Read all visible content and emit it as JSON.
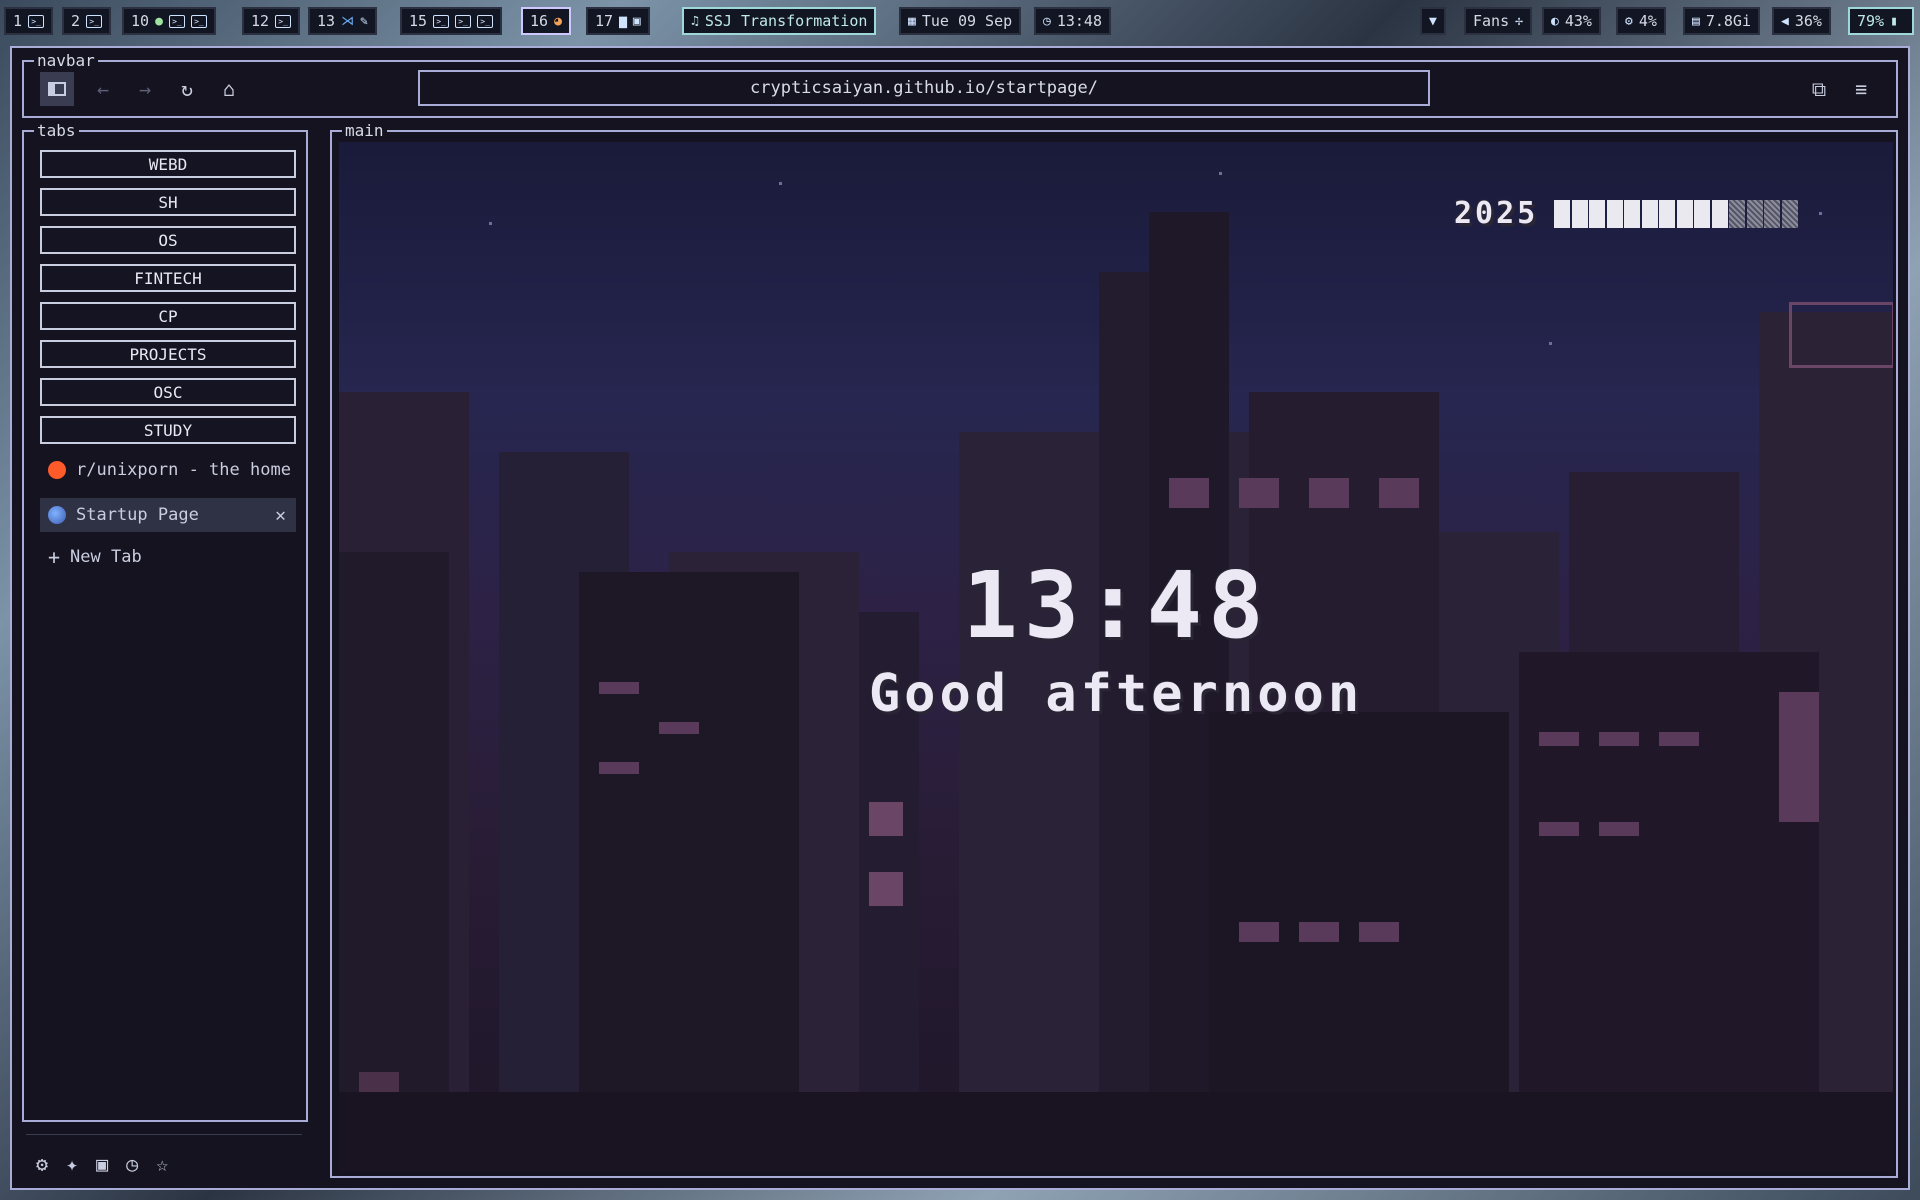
{
  "topbar": {
    "workspaces": [
      {
        "num": "1",
        "icons": [
          "terminal-icon"
        ]
      },
      {
        "num": "2",
        "icons": [
          "terminal-icon"
        ]
      },
      {
        "num": "10",
        "icons": [
          "spotify-icon",
          "terminal-icon",
          "terminal-icon"
        ]
      },
      {
        "num": "12",
        "icons": [
          "terminal-icon"
        ]
      },
      {
        "num": "13",
        "icons": [
          "vscode-icon",
          "editor-icon"
        ]
      },
      {
        "num": "15",
        "icons": [
          "terminal-icon",
          "terminal-icon",
          "terminal-icon"
        ]
      },
      {
        "num": "16",
        "icons": [
          "firefox-icon"
        ],
        "active": true
      },
      {
        "num": "17",
        "icons": [
          "folder-icon",
          "image-viewer-icon"
        ]
      }
    ],
    "music": "SSJ Transformation",
    "date": "Tue 09 Sep",
    "time": "13:48",
    "fans_label": "Fans",
    "brightness": "43%",
    "cpu": "4%",
    "memory": "7.8Gi",
    "volume": "36%",
    "battery": "79%"
  },
  "navbar": {
    "label": "navbar",
    "url": "crypticsaiyan.github.io/startpage/"
  },
  "tabs": {
    "label": "tabs",
    "groups": [
      "WEBD",
      "SH",
      "OS",
      "FINTECH",
      "CP",
      "PROJECTS",
      "OSC",
      "STUDY"
    ],
    "open": [
      {
        "title": "r/unixporn - the home",
        "icon": "reddit-icon",
        "active": false
      },
      {
        "title": "Startup Page",
        "icon": "firefox-icon",
        "active": true
      }
    ],
    "new_tab": "New Tab"
  },
  "main": {
    "label": "main",
    "year": "2025",
    "year_progress": 0.69,
    "clock": "13:48",
    "greeting": "Good afternoon"
  },
  "colors": {
    "accent": "#a9acd6",
    "bg": "#14131f",
    "active_border": "#cfc8ff",
    "teal": "#9fd8d8"
  }
}
